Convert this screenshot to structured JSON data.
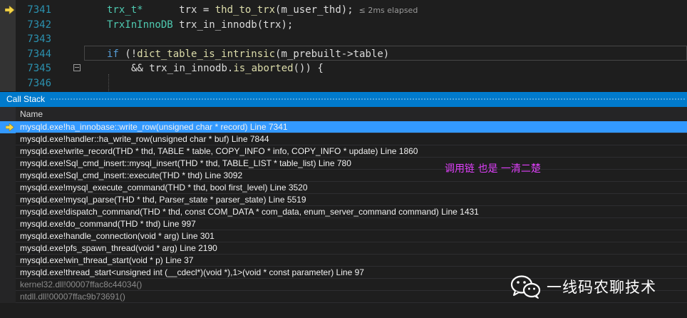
{
  "editor": {
    "lines": [
      {
        "number": "7341",
        "parts": [
          {
            "t": "trx_t*",
            "c": "tok-type"
          },
          {
            "t": "      ",
            "c": ""
          },
          {
            "t": "trx",
            "c": "tok-var"
          },
          {
            "t": " = ",
            "c": ""
          },
          {
            "t": "thd_to_trx",
            "c": "tok-fn"
          },
          {
            "t": "(m_user_thd);",
            "c": ""
          }
        ],
        "elapsed": "≤ 2ms elapsed"
      },
      {
        "number": "7342",
        "parts": [
          {
            "t": "TrxInInnoDB",
            "c": "tok-type"
          },
          {
            "t": " ",
            "c": ""
          },
          {
            "t": "trx_in_innodb",
            "c": "tok-var"
          },
          {
            "t": "(trx);",
            "c": ""
          }
        ]
      },
      {
        "number": "7343",
        "parts": []
      },
      {
        "number": "7344",
        "parts": [
          {
            "t": "if",
            "c": "tok-kw"
          },
          {
            "t": " (!",
            "c": ""
          },
          {
            "t": "dict_table_is_intrinsic",
            "c": "tok-fn"
          },
          {
            "t": "(m_prebuilt->",
            "c": ""
          },
          {
            "t": "table",
            "c": "tok-mem"
          },
          {
            "t": ")",
            "c": ""
          }
        ]
      },
      {
        "number": "7345",
        "indent": true,
        "parts": [
          {
            "t": "&& ",
            "c": ""
          },
          {
            "t": "trx_in_innodb",
            "c": "tok-var"
          },
          {
            "t": ".",
            "c": ""
          },
          {
            "t": "is_aborted",
            "c": "tok-fn"
          },
          {
            "t": "()) {",
            "c": ""
          }
        ]
      },
      {
        "number": "7346",
        "parts": []
      }
    ]
  },
  "call_stack": {
    "title": "Call Stack",
    "column_name": "Name",
    "frames": [
      {
        "text": "mysqld.exe!ha_innobase::write_row(unsigned char * record) Line 7341",
        "current": true
      },
      {
        "text": "mysqld.exe!handler::ha_write_row(unsigned char * buf) Line 7844"
      },
      {
        "text": "mysqld.exe!write_record(THD * thd, TABLE * table, COPY_INFO * info, COPY_INFO * update) Line 1860"
      },
      {
        "text": "mysqld.exe!Sql_cmd_insert::mysql_insert(THD * thd, TABLE_LIST * table_list) Line 780"
      },
      {
        "text": "mysqld.exe!Sql_cmd_insert::execute(THD * thd) Line 3092"
      },
      {
        "text": "mysqld.exe!mysql_execute_command(THD * thd, bool first_level) Line 3520"
      },
      {
        "text": "mysqld.exe!mysql_parse(THD * thd, Parser_state * parser_state) Line 5519"
      },
      {
        "text": "mysqld.exe!dispatch_command(THD * thd, const COM_DATA * com_data, enum_server_command command) Line 1431"
      },
      {
        "text": "mysqld.exe!do_command(THD * thd) Line 997"
      },
      {
        "text": "mysqld.exe!handle_connection(void * arg) Line 301"
      },
      {
        "text": "mysqld.exe!pfs_spawn_thread(void * arg) Line 2190"
      },
      {
        "text": "mysqld.exe!win_thread_start(void * p) Line 37"
      },
      {
        "text": "mysqld.exe!thread_start<unsigned int (__cdecl*)(void *),1>(void * const parameter) Line 97"
      },
      {
        "text": "kernel32.dll!00007ffac8c44034()",
        "dimmed": true
      },
      {
        "text": "ntdll.dll!00007ffac9b73691()",
        "dimmed": true
      }
    ]
  },
  "annotation": "调用链 也是 一清二楚",
  "watermark": {
    "text": "一线码农聊技术",
    "icon": "wechat-icon"
  },
  "colors": {
    "accent": "#007acc",
    "selection": "#3399ff",
    "annotation": "#e040fb",
    "line_number": "#2b91af"
  }
}
